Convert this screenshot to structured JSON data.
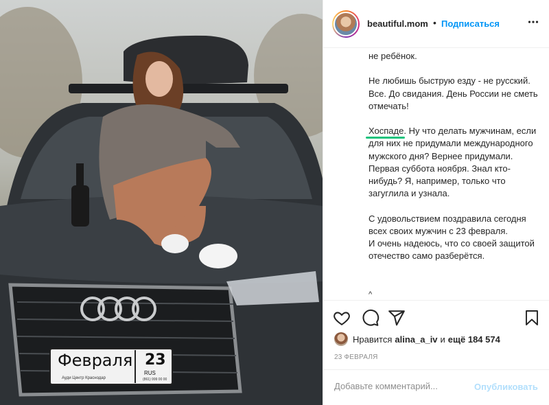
{
  "photo": {
    "plate_text": "Февраля",
    "plate_number": "23",
    "plate_region": "RUS",
    "plate_dealer": "Ауди Центр Краснодар",
    "plate_phone": "(861) 999 00 00"
  },
  "header": {
    "username": "beautiful.mom",
    "separator": "•",
    "follow_label": "Подписаться",
    "more_label": "•••"
  },
  "caption": {
    "text": "не ребёнок.\n\nНе любишь быструю езду - не русский. Все. До свидания. День России не сметь отмечать!\n\nХоспаде. Ну что делать мужчинам, если для них не придумали международного мужского дня? Вернее придумали. Первая суббота ноября. Знал кто-нибудь? Я, например, только что загуглила и узнала.\n\nС удовольствием поздравила сегодня всех своих мужчин с 23 февраля.\nИ очень надеюсь, что со своей защитой отечество само разберётся.",
    "caret": "^"
  },
  "likes": {
    "prefix": "Нравится",
    "liker": "alina_a_iv",
    "conjunction": "и",
    "count": "ещё 184 574"
  },
  "date": "23 ФЕВРАЛЯ",
  "comment": {
    "placeholder": "Добавьте комментарий...",
    "publish_label": "Опубликовать"
  },
  "colors": {
    "link": "#0095f6",
    "publish_disabled": "#b2dffc",
    "highlight_underline": "#19c37d",
    "muted": "#8e8e8e"
  },
  "icons": [
    "heart-icon",
    "comment-icon",
    "share-icon",
    "bookmark-icon",
    "more-icon"
  ]
}
